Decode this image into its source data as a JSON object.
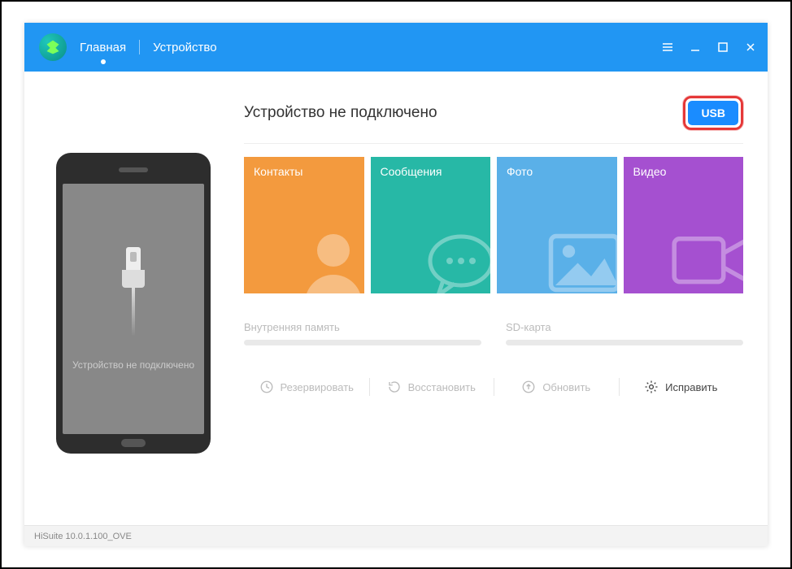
{
  "header": {
    "nav": {
      "home": "Главная",
      "device": "Устройство"
    }
  },
  "phone": {
    "status": "Устройство не подключено"
  },
  "main": {
    "title": "Устройство не подключено",
    "usb_button": "USB"
  },
  "tiles": {
    "contacts": "Контакты",
    "messages": "Сообщения",
    "photo": "Фото",
    "video": "Видео"
  },
  "storage": {
    "internal": "Внутренняя память",
    "sd": "SD-карта"
  },
  "actions": {
    "backup": "Резервировать",
    "restore": "Восстановить",
    "update": "Обновить",
    "fix": "Исправить"
  },
  "footer": {
    "version": "HiSuite 10.0.1.100_OVE"
  }
}
